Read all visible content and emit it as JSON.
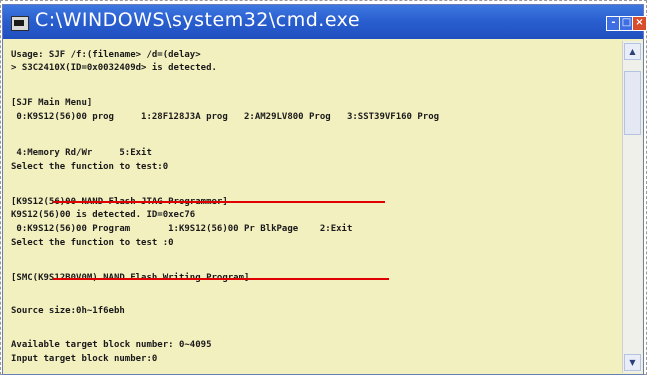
{
  "window": {
    "title": "C:\\WINDOWS\\system32\\cmd.exe",
    "controls": {
      "minimize": "-",
      "maximize": "□",
      "close": "×"
    },
    "icons": {
      "app": "console-icon",
      "scroll_up": "arrow-up-icon",
      "scroll_down": "arrow-down-icon"
    },
    "colors": {
      "title_bar": "#2a5fd0",
      "console_bg": "#f3f0c0",
      "strike": "#e00000"
    }
  },
  "console": {
    "lines": [
      "Usage: SJF /f:(filename> /d=(delay>",
      "> S3C2410X(ID=0x0032409d> is detected.",
      "[SJF Main Menu]",
      " 0:K9S12(56)00 prog     1:28F128J3A prog   2:AM29LV800 Prog   3:SST39VF160 Prog",
      " 4:Memory Rd/Wr     5:Exit",
      "Select the function to test:0",
      "[K9S12(56)00 NAND Flash JTAG Programmer]",
      "K9S12(56)00 is detected. ID=0xec76",
      " 0:K9S12(56)00 Program       1:K9S12(56)00 Pr BlkPage    2:Exit",
      "Select the function to test :0",
      "[SMC(K9S12B0V0M) NAND Flash Writing Program]",
      "Source size:0h~1f6ebh",
      "Available target block number: 0~4095",
      "Input target block number:0"
    ]
  }
}
